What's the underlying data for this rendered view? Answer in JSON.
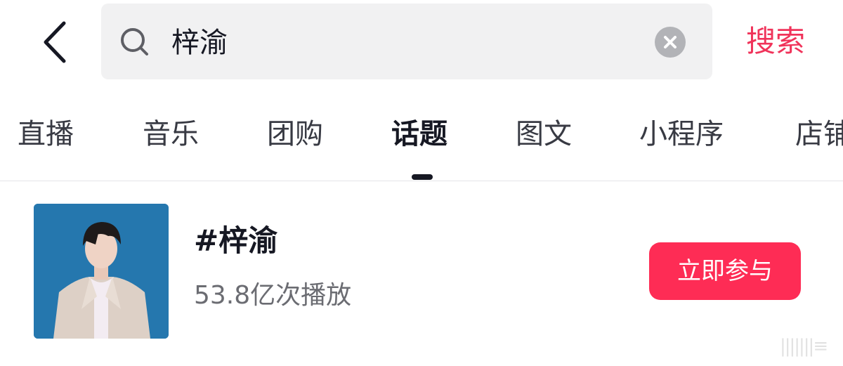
{
  "header": {
    "search_query": "梓渝",
    "search_button_label": "搜索"
  },
  "tabs": [
    {
      "label": "直播",
      "active": false
    },
    {
      "label": "音乐",
      "active": false
    },
    {
      "label": "团购",
      "active": false
    },
    {
      "label": "话题",
      "active": true
    },
    {
      "label": "图文",
      "active": false
    },
    {
      "label": "小程序",
      "active": false
    },
    {
      "label": "店铺",
      "active": false
    }
  ],
  "topic": {
    "title": "#梓渝",
    "plays": "53.8亿次播放",
    "join_label": "立即参与"
  },
  "colors": {
    "accent": "#fe2c55",
    "search_accent": "#f0335a",
    "text_primary": "#161823",
    "text_secondary": "#6b6c72",
    "search_bg": "#f1f1f2"
  },
  "icons": [
    "back-arrow-icon",
    "search-icon",
    "clear-icon"
  ]
}
